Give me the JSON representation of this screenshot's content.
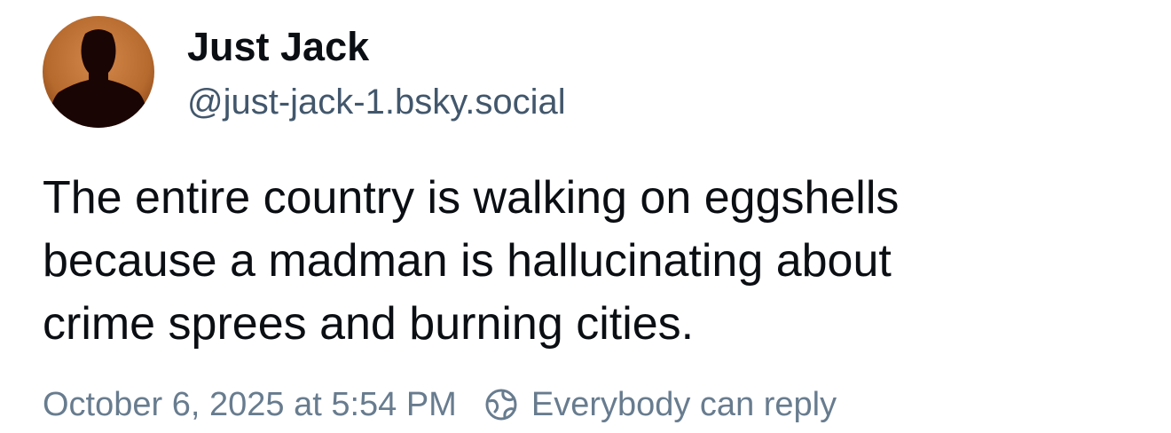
{
  "author": {
    "display_name": "Just Jack",
    "handle": "@just-jack-1.bsky.social",
    "avatar_icon": "silhouette-avatar",
    "avatar_colors": {
      "background": "#b66a2e",
      "silhouette": "#1a0505"
    }
  },
  "post": {
    "lines": [
      "The entire country is walking on eggshells",
      "because a madman is hallucinating about",
      "crime sprees and burning cities."
    ]
  },
  "meta": {
    "timestamp": "October 6, 2025 at 5:54 PM",
    "reply_icon": "globe-reply-icon",
    "reply_setting": "Everybody can reply"
  },
  "colors": {
    "text_primary": "#0b0f14",
    "text_secondary": "#42576c",
    "text_muted": "#687c8f"
  }
}
